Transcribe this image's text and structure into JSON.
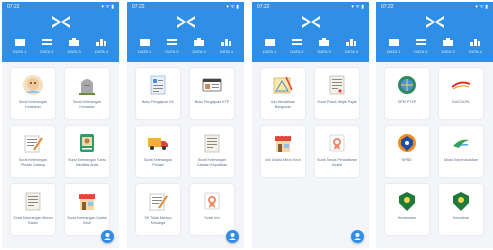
{
  "status": {
    "time": "07:22",
    "right": "▾ ᯤ ▮"
  },
  "tabs": [
    "DATA 1",
    "DATA 2",
    "DATA 3",
    "DATA 4"
  ],
  "phones": [
    {
      "items": [
        {
          "label": "Surat Keterangan Kelahiran",
          "icon": "baby-icon"
        },
        {
          "label": "Surat Keterangan Kematian",
          "icon": "tombstone-icon"
        },
        {
          "label": "Surat Keterangan Pindah Datang",
          "icon": "document-sign-icon"
        },
        {
          "label": "Surat Keterangan Kartu Identitas Anak",
          "icon": "id-card-icon"
        },
        {
          "label": "Surat Keterangan Belum Kawin",
          "icon": "document-icon"
        },
        {
          "label": "Surat Keterangan Usaha Kecil",
          "icon": "store-icon"
        }
      ]
    },
    {
      "items": [
        {
          "label": "Buku Pengajuan KK",
          "icon": "form-icon"
        },
        {
          "label": "Buku Pengajuan KTP",
          "icon": "id-card-icon"
        },
        {
          "label": "Surat Keterangan Pindah",
          "icon": "truck-icon"
        },
        {
          "label": "Surat Keterangan Catatan Kepolisian",
          "icon": "document-icon"
        },
        {
          "label": "SK Tidak Mampu Keluarga",
          "icon": "document-sign-icon"
        },
        {
          "label": "Surat Izin",
          "icon": "certificate-icon"
        }
      ]
    },
    {
      "items": [
        {
          "label": "Izin Mendirikan Bangunan",
          "icon": "blueprint-icon"
        },
        {
          "label": "Surat Pokok Wajib Pajak",
          "icon": "document-icon"
        },
        {
          "label": "Izin Usaha Mikro Kecil",
          "icon": "store-icon"
        },
        {
          "label": "Surat Tanda Pendaftaran Usaha",
          "icon": "certificate-icon"
        }
      ]
    },
    {
      "items": [
        {
          "label": "DPM PTSP",
          "icon": "globe-emblem-icon"
        },
        {
          "label": "DUKCAPIL",
          "icon": "swoosh-logo-icon"
        },
        {
          "label": "BPBD",
          "icon": "shield-emblem-icon"
        },
        {
          "label": "Dinas Kependudukan",
          "icon": "bird-logo-icon"
        },
        {
          "label": "Kecamatan",
          "icon": "green-emblem-icon"
        },
        {
          "label": "Kelurahan",
          "icon": "green-emblem-icon"
        }
      ]
    }
  ]
}
